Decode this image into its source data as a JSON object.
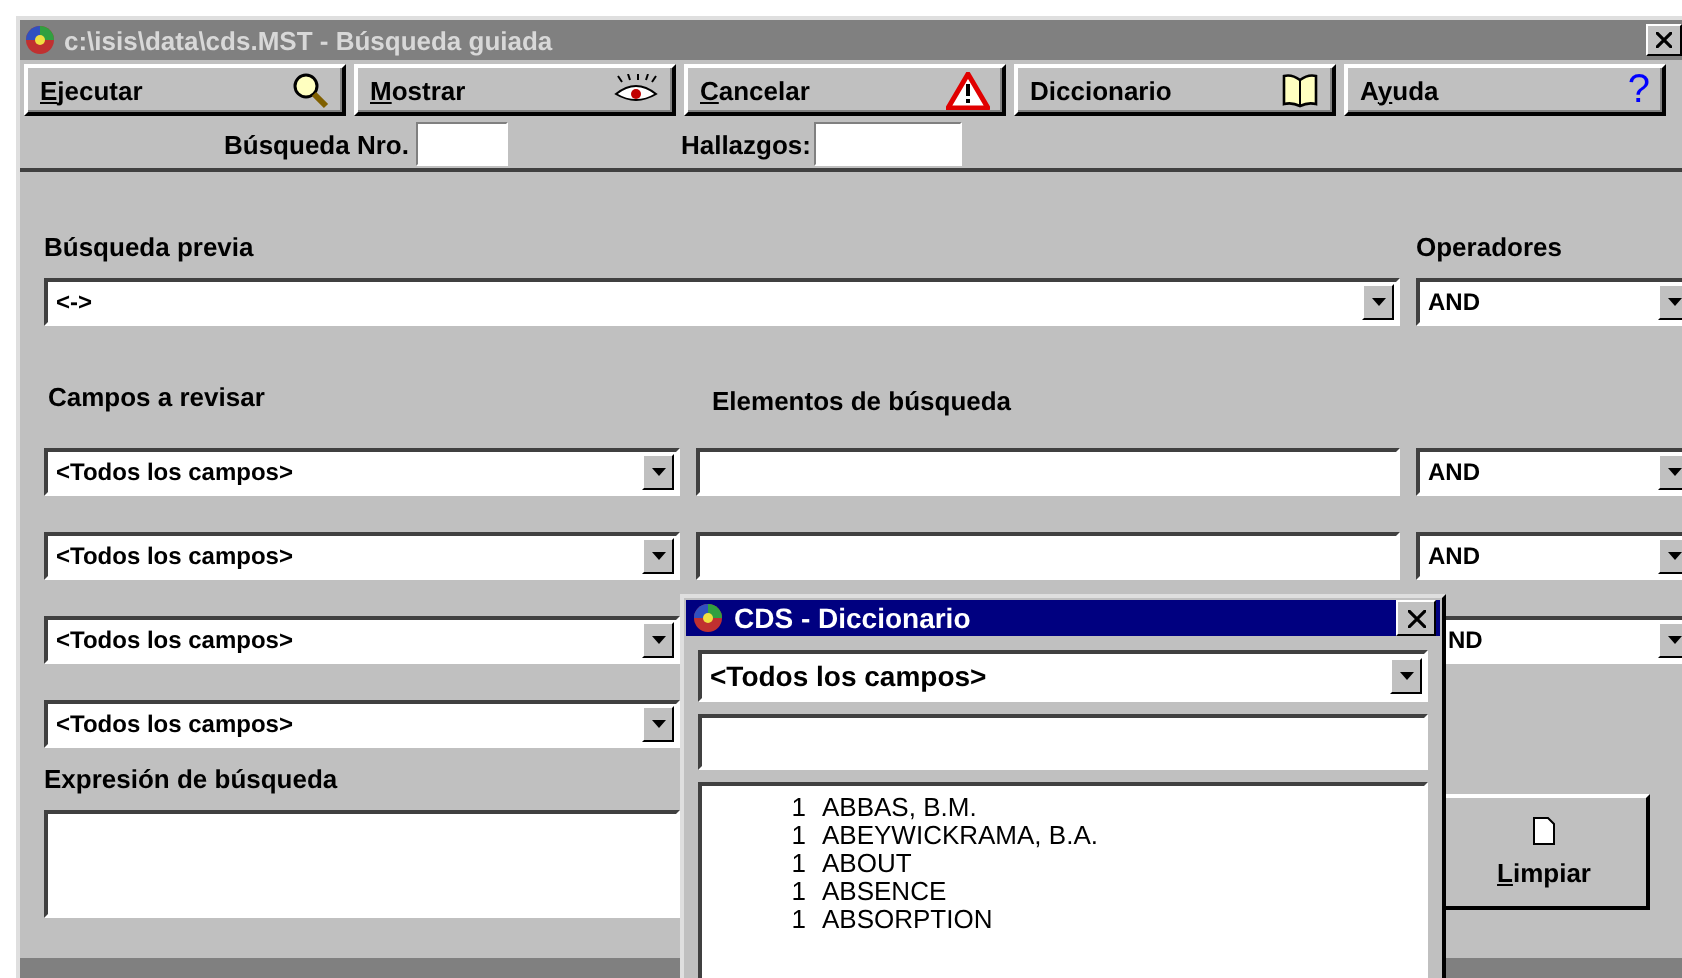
{
  "window": {
    "title": "c:\\isis\\data\\cds.MST - Búsqueda guiada"
  },
  "toolbar": [
    {
      "key": "E",
      "after": "jecutar",
      "kind": "search"
    },
    {
      "key": "M",
      "after": "ostrar",
      "kind": "eye"
    },
    {
      "key": "C",
      "after": "ancelar",
      "kind": "warning"
    },
    {
      "before": "Diccionario",
      "kind": "book"
    },
    {
      "before": "A",
      "key": "y",
      "after": "uda",
      "kind": "help",
      "icon_text": "?"
    }
  ],
  "search_number": {
    "label": "Búsqueda Nro."
  },
  "hits": {
    "label": "Hallazgos:"
  },
  "previous_search": {
    "label": "Búsqueda previa",
    "value": "<->"
  },
  "operators_label": "Operadores",
  "previous_operator": "AND",
  "fields_label": "Campos a revisar",
  "elements_label": "Elementos de búsqueda",
  "rows": [
    {
      "field": "<Todos los campos>",
      "term_field_visible": true,
      "operator": "AND"
    },
    {
      "field": "<Todos los campos>",
      "term_field_visible": true,
      "operator": "AND"
    },
    {
      "field": "<Todos los campos>",
      "term_field_visible": false,
      "operator": "ND",
      "operator_covered": true
    },
    {
      "field": "<Todos los campos>",
      "term_field_visible": false
    }
  ],
  "expression_label": "Expresión de búsqueda",
  "clear_button": {
    "key": "L",
    "after": "impiar"
  },
  "dictionary": {
    "title": "CDS - Diccionario",
    "field": "<Todos los campos>",
    "terms": [
      {
        "count": "1",
        "term": "ABBAS, B.M."
      },
      {
        "count": "1",
        "term": "ABEYWICKRAMA, B.A."
      },
      {
        "count": "1",
        "term": "ABOUT"
      },
      {
        "count": "1",
        "term": "ABSENCE"
      },
      {
        "count": "1",
        "term": "ABSORPTION"
      }
    ]
  }
}
